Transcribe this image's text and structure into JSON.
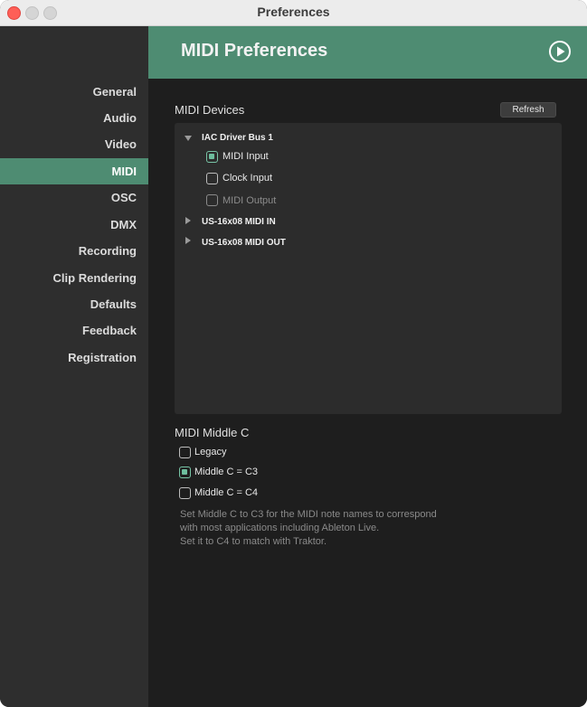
{
  "window": {
    "title": "Preferences"
  },
  "sidebar": {
    "items": [
      {
        "label": "General",
        "active": false
      },
      {
        "label": "Audio",
        "active": false
      },
      {
        "label": "Video",
        "active": false
      },
      {
        "label": "MIDI",
        "active": true
      },
      {
        "label": "OSC",
        "active": false
      },
      {
        "label": "DMX",
        "active": false
      },
      {
        "label": "Recording",
        "active": false
      },
      {
        "label": "Clip Rendering",
        "active": false
      },
      {
        "label": "Defaults",
        "active": false
      },
      {
        "label": "Feedback",
        "active": false
      },
      {
        "label": "Registration",
        "active": false
      }
    ]
  },
  "header": {
    "title": "MIDI Preferences",
    "icon": "play-circle-icon"
  },
  "midi_devices": {
    "title": "MIDI Devices",
    "refresh_label": "Refresh",
    "devices": [
      {
        "name": "IAC Driver Bus 1",
        "expanded": true,
        "options": [
          {
            "label": "MIDI Input",
            "checked": true,
            "enabled": true
          },
          {
            "label": "Clock Input",
            "checked": false,
            "enabled": true
          },
          {
            "label": "MIDI Output",
            "checked": false,
            "enabled": false
          }
        ]
      },
      {
        "name": "US-16x08 MIDI IN",
        "expanded": false
      },
      {
        "name": "US-16x08 MIDI OUT",
        "expanded": false
      }
    ]
  },
  "middle_c": {
    "title": "MIDI Middle C",
    "options": [
      {
        "label": "Legacy",
        "checked": false
      },
      {
        "label": "Middle C = C3",
        "checked": true
      },
      {
        "label": "Middle C = C4",
        "checked": false
      }
    ],
    "help_lines": [
      "Set Middle C to C3 for the MIDI note names to correspond",
      "with most applications including Ableton Live.",
      "Set it to C4 to match with Traktor."
    ]
  },
  "colors": {
    "accent": "#4e8c72",
    "checkbox_checked": "#6dbd9d",
    "sidebar_bg": "#2e2e2e",
    "content_bg": "#1e1e1e",
    "panel_bg": "#2c2c2c"
  }
}
